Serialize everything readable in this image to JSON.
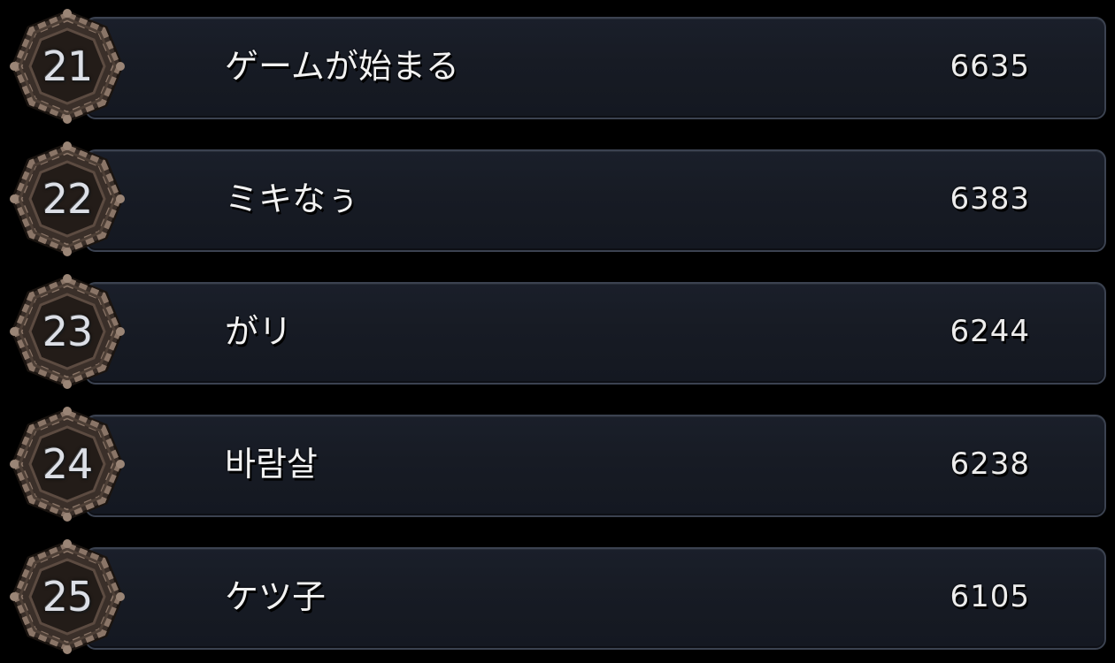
{
  "leaderboard": {
    "entries": [
      {
        "rank": "21",
        "name": "ゲームが始まる",
        "score": "6635"
      },
      {
        "rank": "22",
        "name": "ミキなぅ",
        "score": "6383"
      },
      {
        "rank": "23",
        "name": "がリ",
        "score": "6244"
      },
      {
        "rank": "24",
        "name": "바람살",
        "score": "6238"
      },
      {
        "rank": "25",
        "name": "ケツ子",
        "score": "6105"
      }
    ],
    "icons": {
      "rank_badge": "chain-frame-icon"
    },
    "colors": {
      "background": "#000000",
      "panel": "#171b24",
      "panel_border": "#3b4250",
      "badge_metal": "#6b5a4e",
      "text": "#f2f2f2"
    }
  }
}
